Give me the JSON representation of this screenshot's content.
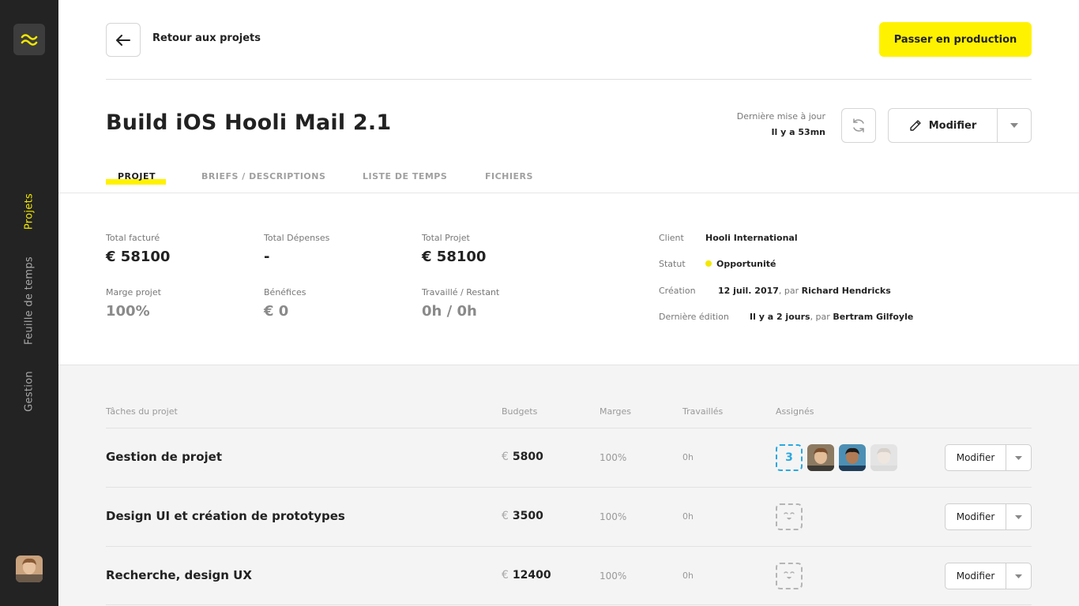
{
  "sidebar": {
    "nav": [
      {
        "label": "Projets",
        "active": true
      },
      {
        "label": "Feuille de temps",
        "active": false
      },
      {
        "label": "Gestion",
        "active": false
      }
    ]
  },
  "topbar": {
    "back_label": "Retour aux projets",
    "production_button": "Passer en production"
  },
  "project": {
    "title": "Build iOS Hooli Mail 2.1",
    "last_update_label": "Dernière mise à jour",
    "last_update_value": "Il y a 53mn",
    "edit_button": "Modifier"
  },
  "tabs": [
    {
      "label": "PROJET",
      "active": true
    },
    {
      "label": "BRIEFS / DESCRIPTIONS",
      "active": false
    },
    {
      "label": "LISTE DE TEMPS",
      "active": false
    },
    {
      "label": "FICHIERS",
      "active": false
    }
  ],
  "stats": {
    "total_facture": {
      "label": "Total facturé",
      "value": "€ 58100"
    },
    "total_depenses": {
      "label": "Total Dépenses",
      "value": "-"
    },
    "total_projet": {
      "label": "Total Projet",
      "value": "€ 58100"
    },
    "marge_projet": {
      "label": "Marge projet",
      "value": "100%"
    },
    "benefices": {
      "label": "Bénéfices",
      "value": "€ 0"
    },
    "travaille_restant": {
      "label": "Travaillé / Restant",
      "value": "0h / 0h"
    }
  },
  "info": {
    "client_label": "Client",
    "client_value": "Hooli International",
    "statut_label": "Statut",
    "statut_value": "Opportunité",
    "statut_color": "#f2e800",
    "creation_label": "Création",
    "creation_date": "12 juil. 2017",
    "creation_by": ", par",
    "creation_author": "Richard Hendricks",
    "edition_label": "Dernière édition",
    "edition_date": "Il y a 2 jours",
    "edition_by": ", par",
    "edition_author": "Bertram Gilfoyle"
  },
  "tasks": {
    "headers": {
      "name": "Tâches du projet",
      "budgets": "Budgets",
      "marges": "Marges",
      "travailles": "Travaillés",
      "assignes": "Assignés"
    },
    "currency": "€",
    "rows": [
      {
        "name": "Gestion de projet",
        "budget": "5800",
        "marge": "100%",
        "worked": "0h",
        "assignee_count": "3",
        "edit": "Modifier"
      },
      {
        "name": "Design UI et création de prototypes",
        "budget": "3500",
        "marge": "100%",
        "worked": "0h",
        "edit": "Modifier"
      },
      {
        "name": "Recherche, design UX",
        "budget": "12400",
        "marge": "100%",
        "worked": "0h",
        "edit": "Modifier"
      }
    ]
  },
  "colors": {
    "accent": "#fff200",
    "sidebar": "#232323",
    "assignee_blue": "#2aa8e0"
  }
}
